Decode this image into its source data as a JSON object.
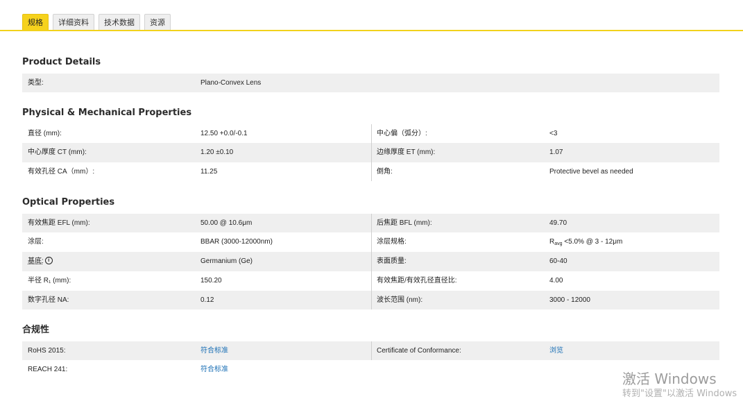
{
  "tabs": [
    "规格",
    "详细资料",
    "技术数据",
    "资源"
  ],
  "product_details": {
    "title": "Product Details",
    "type_label": "类型:",
    "type_value": "Plano-Convex Lens"
  },
  "physical": {
    "title": "Physical & Mechanical Properties",
    "rows": [
      {
        "l1": "直径 (mm):",
        "v1": "12.50 +0.0/-0.1",
        "l2": "中心偏（弧分）:",
        "v2": "<3"
      },
      {
        "l1": "中心厚度 CT (mm):",
        "v1": "1.20 ±0.10",
        "l2": "边缘厚度 ET (mm):",
        "v2": "1.07"
      },
      {
        "l1": "有效孔径 CA（mm）:",
        "v1": "11.25",
        "l2": "倒角:",
        "v2": "Protective bevel as needed"
      }
    ]
  },
  "optical": {
    "title": "Optical Properties",
    "rows": [
      {
        "l1": "有效焦距 EFL (mm):",
        "v1": "50.00 @ 10.6μm",
        "l2": "后焦距 BFL (mm):",
        "v2": "49.70"
      },
      {
        "l1": "涂层:",
        "v1": "BBAR (3000-12000nm)",
        "l2": "涂层规格:",
        "v2_pre": "R",
        "v2_sub": "avg",
        "v2_post": " <5.0% @ 3 - 12μm"
      },
      {
        "l1": "基底:",
        "l1_icon": "i",
        "v1": "Germanium (Ge)",
        "l2": "表面质量:",
        "v2": "60-40"
      },
      {
        "l1": "半径 R₁ (mm):",
        "v1": "150.20",
        "l2": "有效焦距/有效孔径直径比:",
        "v2": "4.00"
      },
      {
        "l1": "数字孔径 NA:",
        "v1": "0.12",
        "l2": "波长范围 (nm):",
        "v2": "3000 - 12000"
      }
    ]
  },
  "compliance": {
    "title": "合规性",
    "rows": [
      {
        "l1": "RoHS 2015:",
        "v1": "符合标准",
        "l2": "Certificate of Conformance:",
        "v2": "浏览"
      },
      {
        "l1": "REACH 241:",
        "v1": "符合标准"
      }
    ]
  },
  "watermark": {
    "line1": "激活 Windows",
    "line2": "转到\"设置\"以激活 Windows"
  }
}
